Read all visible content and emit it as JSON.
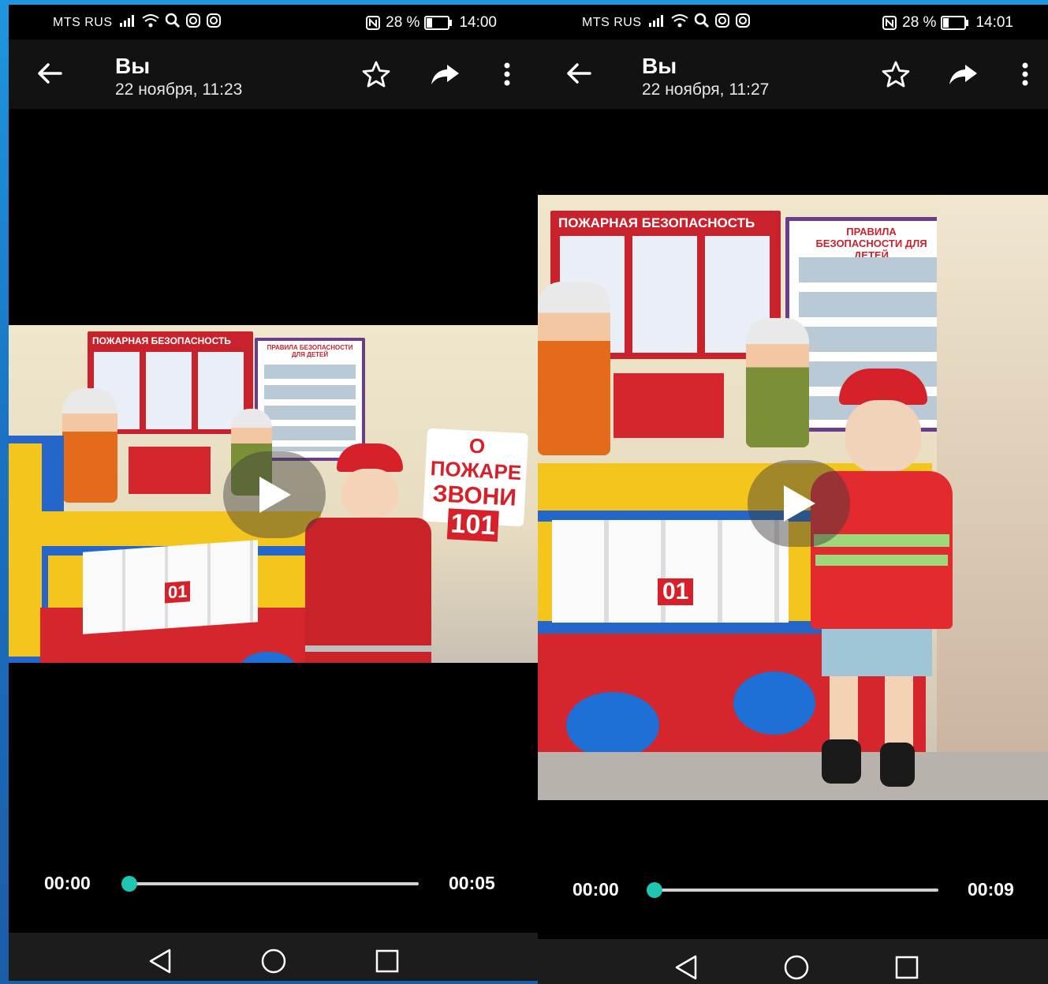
{
  "screens": [
    {
      "status": {
        "carrier": "MTS RUS",
        "battery": "28 %",
        "time": "14:00"
      },
      "header": {
        "title": "Вы",
        "subtitle": "22 ноября, 11:23"
      },
      "video": {
        "poster_title_left": "ПОЖАРНАЯ БЕЗОПАСНОСТЬ",
        "poster_title_right": "ПРАВИЛА БЕЗОПАСНОСТИ ДЛЯ ДЕТЕЙ",
        "sign_text_1": "О ПОЖАРЕ",
        "sign_text_2": "ЗВОНИ",
        "sign_text_3": "101",
        "booklet_number": "01"
      },
      "player": {
        "current_time": "00:00",
        "duration": "00:05",
        "progress": 0
      }
    },
    {
      "status": {
        "carrier": "MTS RUS",
        "battery": "28 %",
        "time": "14:01"
      },
      "header": {
        "title": "Вы",
        "subtitle": "22 ноября, 11:27"
      },
      "video": {
        "poster_title_left": "ПОЖАРНАЯ БЕЗОПАСНОСТЬ",
        "poster_title_right": "ПРАВИЛА БЕЗОПАСНОСТИ ДЛЯ ДЕТЕЙ",
        "booklet_number": "01"
      },
      "player": {
        "current_time": "00:00",
        "duration": "00:09",
        "progress": 0
      }
    }
  ],
  "colors": {
    "accent": "#1ec6b0",
    "topbar": "#121212",
    "navbar": "#1c1c1c",
    "frame": "#1b78c7"
  }
}
